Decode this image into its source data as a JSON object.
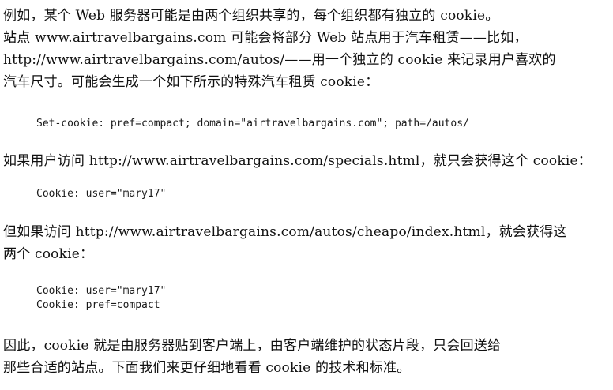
{
  "paragraph1": {
    "lines": [
      "例如，某个 Web 服务器可能是由两个组织共享的，每个组织都有独立的 cookie。",
      "站点 www.airtravelbargains.com 可能会将部分 Web 站点用于汽车租赁——比如，",
      "http://www.airtravelbargains.com/autos/——用一个独立的 cookie 来记录用户喜欢的",
      "汽车尺寸。可能会生成一个如下所示的特殊汽车租赁 cookie："
    ]
  },
  "code1": "Set-cookie: pref=compact; domain=\"airtravelbargains.com\"; path=/autos/",
  "paragraph2": "如果用户访问 http://www.airtravelbargains.com/specials.html，就只会获得这个 cookie：",
  "code2": "Cookie: user=\"mary17\"",
  "paragraph3": {
    "lines": [
      "但如果访问 http://www.airtravelbargains.com/autos/cheapo/index.html，就会获得这",
      "两个 cookie："
    ]
  },
  "code3": [
    "Cookie: user=\"mary17\"",
    "Cookie: pref=compact"
  ],
  "paragraph4": {
    "lines": [
      "因此，cookie 就是由服务器贴到客户端上，由客户端维护的状态片段，只会回送给",
      "那些合适的站点。下面我们来更仔细地看看 cookie 的技术和标准。"
    ]
  }
}
